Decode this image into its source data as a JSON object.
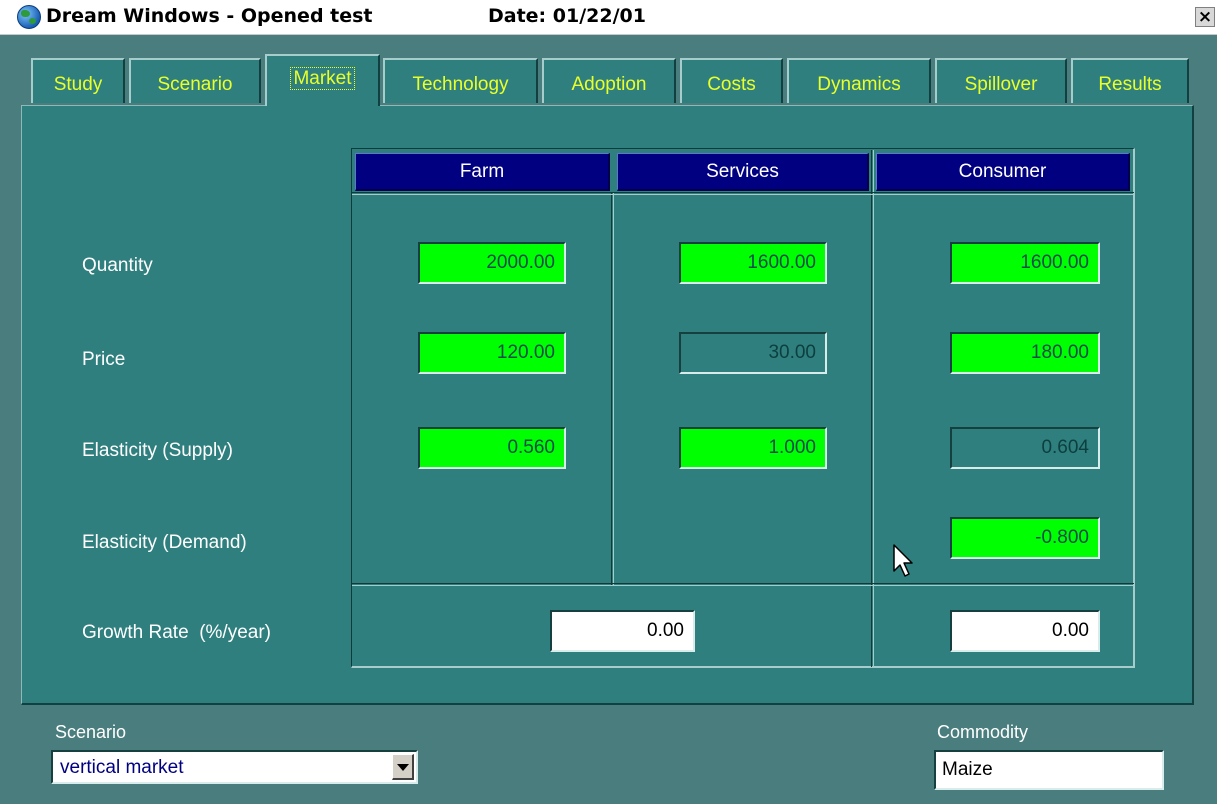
{
  "window": {
    "title": "Dream Windows - Opened test",
    "date": "Date: 01/22/01",
    "close_glyph": "×"
  },
  "tabs": [
    {
      "label": "Study"
    },
    {
      "label": "Scenario"
    },
    {
      "label": "Market",
      "active": true
    },
    {
      "label": "Technology"
    },
    {
      "label": "Adoption"
    },
    {
      "label": "Costs"
    },
    {
      "label": "Dynamics"
    },
    {
      "label": "Spillover"
    },
    {
      "label": "Results"
    }
  ],
  "market": {
    "columns": [
      "Farm",
      "Services",
      "Consumer"
    ],
    "rows": [
      "Quantity",
      "Price",
      "Elasticity (Supply)",
      "Elasticity (Demand)",
      "Growth Rate  (%/year)"
    ],
    "quantity": {
      "farm": "2000.00",
      "services": "1600.00",
      "consumer": "1600.00"
    },
    "price": {
      "farm": "120.00",
      "services": "30.00",
      "consumer": "180.00"
    },
    "elasticity_supply": {
      "farm": "0.560",
      "services": "1.000",
      "consumer": "0.604"
    },
    "elasticity_demand": {
      "consumer": "-0.800"
    },
    "growth_rate": {
      "farm_services": "0.00",
      "consumer": "0.00"
    }
  },
  "footer": {
    "scenario_label": "Scenario",
    "scenario_value": "vertical market",
    "commodity_label": "Commodity",
    "commodity_value": "Maize"
  },
  "colors": {
    "editable_field": "#00ff00",
    "panel": "#2f7f7f",
    "header": "#000080",
    "tab_text": "#e8ff2a"
  }
}
